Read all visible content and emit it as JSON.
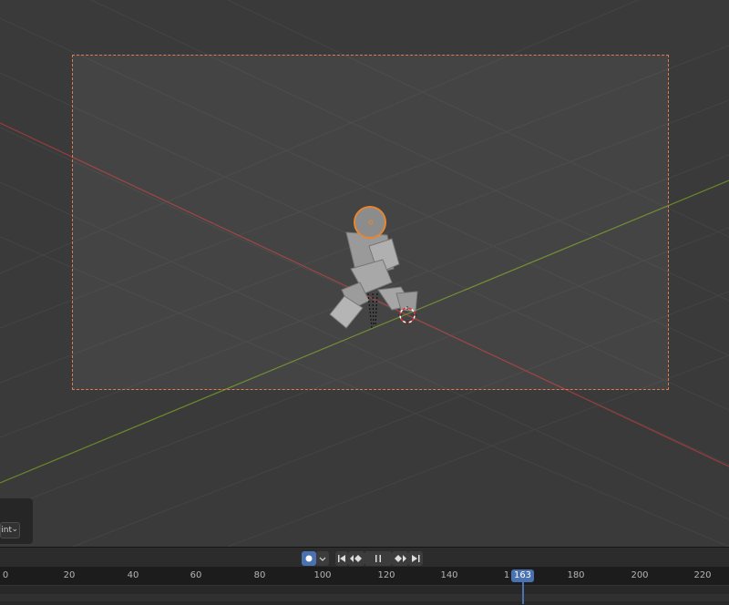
{
  "viewport": {
    "side_panel": {
      "dropdown_value": "aint"
    }
  },
  "timeline": {
    "record_icon": "record-dot",
    "play_controls": [
      "jump-start-icon",
      "prev-keyframe-icon",
      "pause-icon",
      "next-keyframe-icon",
      "jump-end-icon"
    ],
    "ruler_labels": [
      "0",
      "20",
      "40",
      "60",
      "80",
      "100",
      "120",
      "140",
      "1",
      "180",
      "200",
      "220"
    ],
    "current_frame": "163"
  },
  "colors": {
    "accent": "#4a72b0",
    "x_axis": "#9b3b3b",
    "y_axis": "#6b8a2a",
    "selection_outline": "#e07a4f"
  }
}
